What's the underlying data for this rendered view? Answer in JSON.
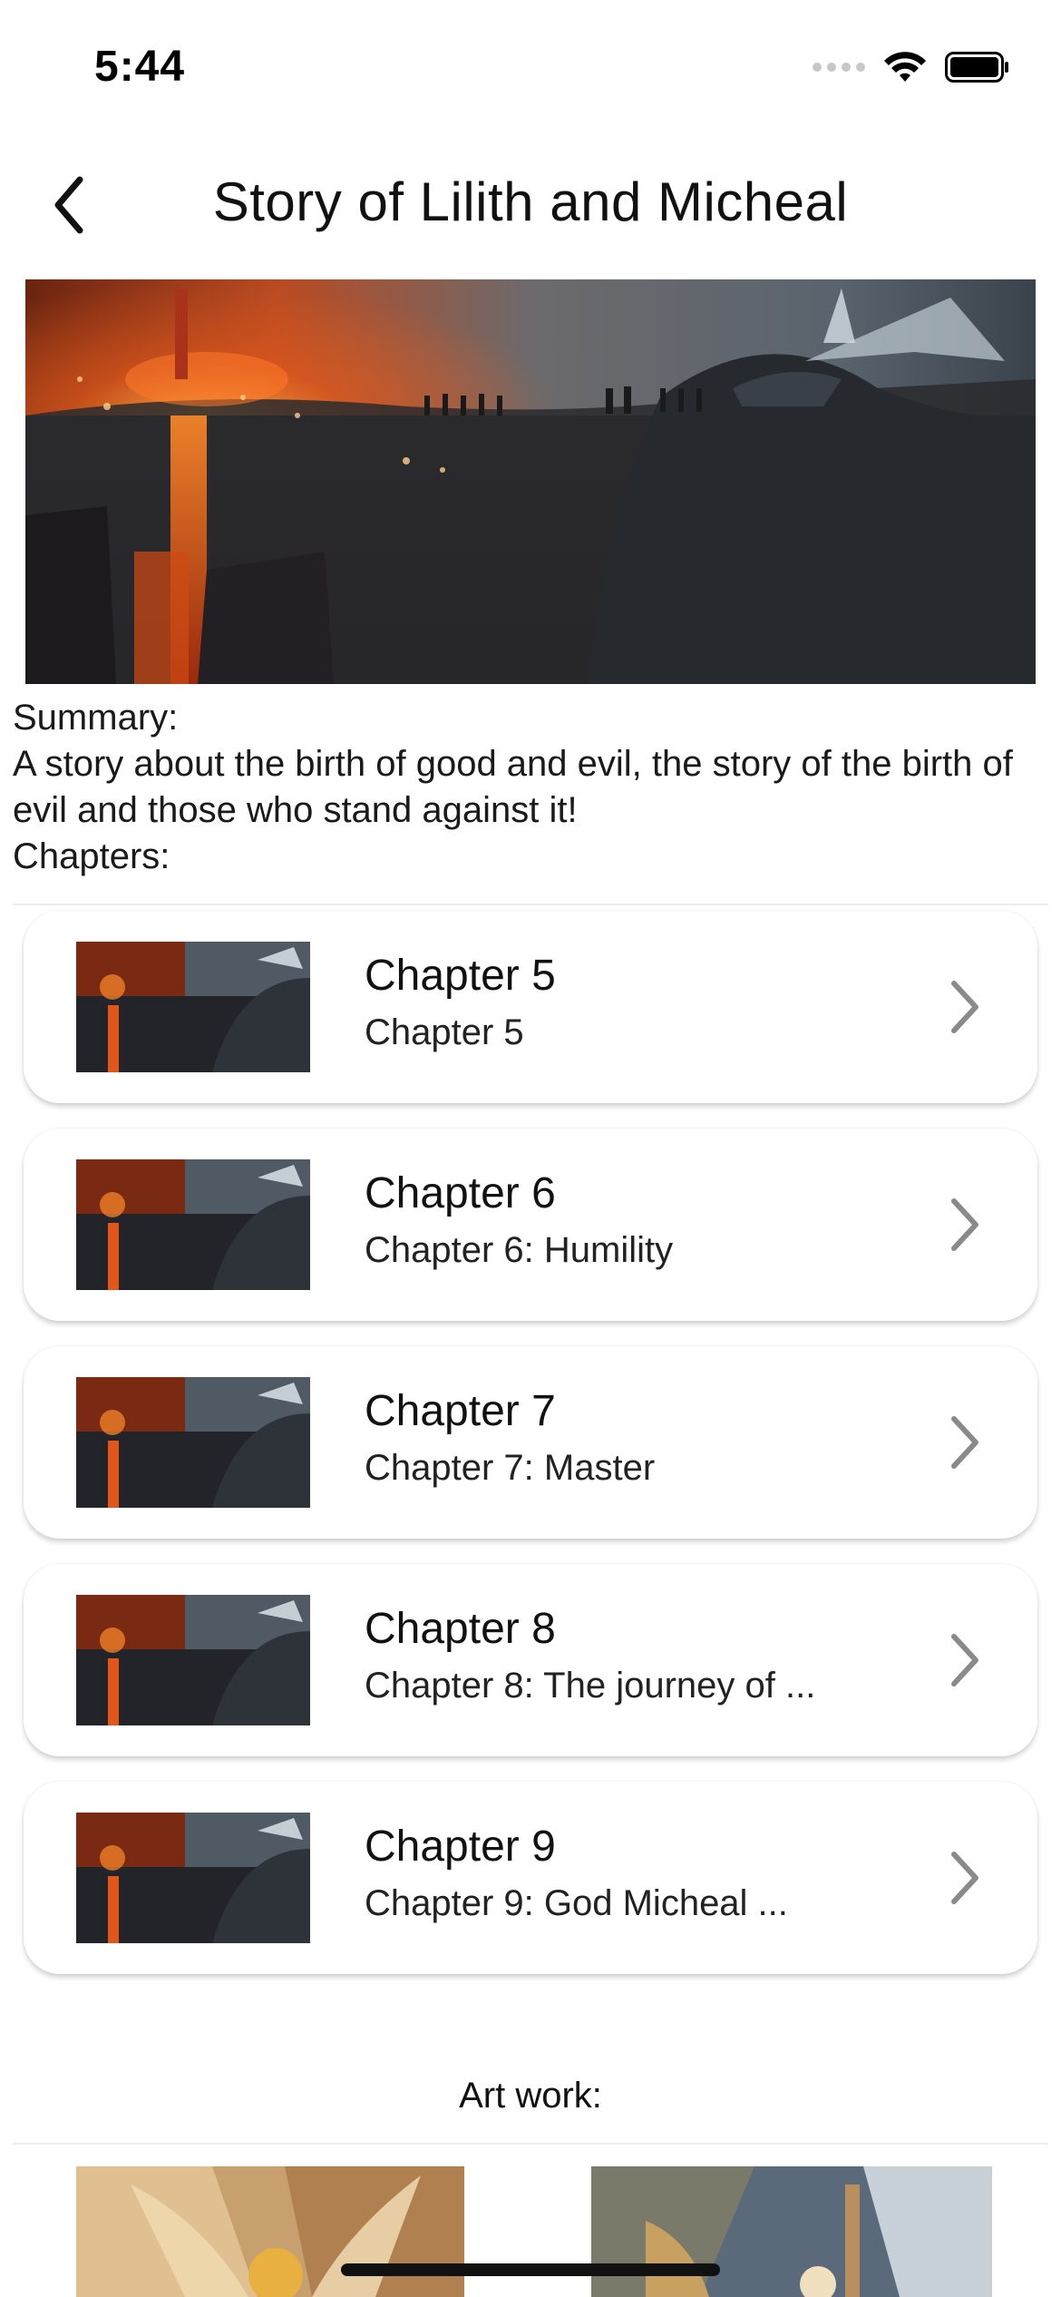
{
  "status_bar": {
    "time": "5:44"
  },
  "nav": {
    "title": "Story of Lilith and Micheal",
    "back_icon": "chevron-left-icon"
  },
  "summary": {
    "label": "Summary:",
    "text": "A story about the birth of good and evil, the story of the birth of evil and those who stand against it!",
    "chapters_label": "Chapters:"
  },
  "chapters": [
    {
      "title": "Chapter 5",
      "subtitle": "Chapter 5"
    },
    {
      "title": "Chapter 6",
      "subtitle": "Chapter 6: Humility"
    },
    {
      "title": "Chapter 7",
      "subtitle": "Chapter 7: Master"
    },
    {
      "title": "Chapter 8",
      "subtitle": "Chapter 8: The journey of ..."
    },
    {
      "title": "Chapter 9",
      "subtitle": "Chapter 9: God  Micheal ..."
    }
  ],
  "artwork": {
    "label": "Art work:"
  },
  "colors": {
    "chevron": "#8a8a8a",
    "card_bg": "#ffffff",
    "fire": "#e25a1c",
    "storm": "#4a5560"
  }
}
